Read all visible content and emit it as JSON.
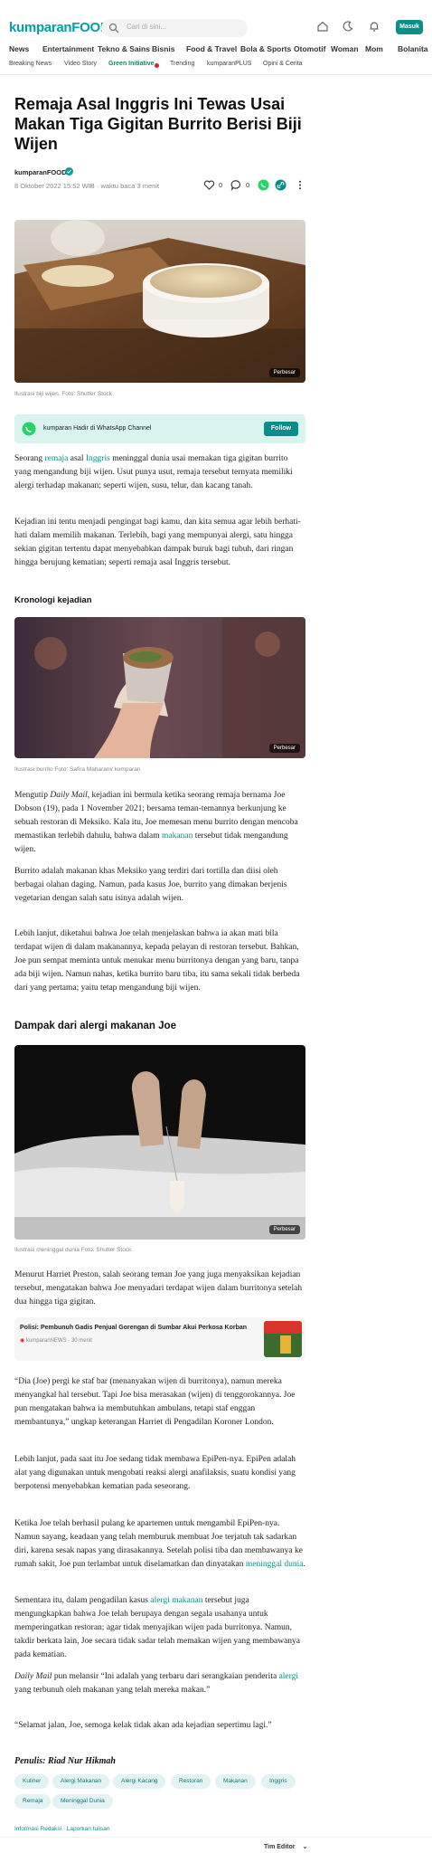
{
  "header": {
    "logo_main": "kumparan",
    "logo_sub": "FOOD",
    "search_placeholder": "Cari di sini...",
    "login_label": "Masuk"
  },
  "nav": {
    "items": [
      "News",
      "Entertainment",
      "Tekno & Sains",
      "Bisnis",
      "Food & Travel",
      "Bola & Sports",
      "Otomotif",
      "Woman",
      "Mom",
      "Bolanita"
    ]
  },
  "subnav": {
    "items": [
      "Breaking News",
      "Video Story",
      "Green Initiative",
      "Trending",
      "kumparanPLUS",
      "Opini & Cerita"
    ]
  },
  "article": {
    "title": "Remaja Asal Inggris Ini Tewas Usai Makan Tiga Gigitan Burrito Berisi Biji Wijen",
    "author": "kumparanFOOD",
    "meta": "8 Oktober 2022 15:52 WIB · waktu baca 3 menit",
    "likes": "0",
    "comments": "0"
  },
  "figures": {
    "zoom_label": "Perbesar",
    "caption1": "Ilustrasi biji wijen. Foto: Shutter Stock",
    "caption2": "Ilustrasi burrito Foto: Safira Maharani/ kumparan",
    "caption3": "Ilustrasi meninggal dunia Foto: Shutter Stock"
  },
  "wa_banner": {
    "text": "kumparan Hadir di WhatsApp Channel",
    "follow_label": "Follow"
  },
  "body": {
    "p1_a": "Seorang ",
    "p1_link1": "remaja",
    "p1_b": " asal ",
    "p1_link2": "Inggris",
    "p1_c": " meninggal dunia usai memakan tiga gigitan burrito yang mengandung biji wijen. Usut punya usut, remaja tersebut ternyata memiliki alergi terhadap makanan; seperti wijen, susu, telur, dan kacang tanah.",
    "p2": "Kejadian ini tentu menjadi pengingat bagi kamu, dan kita semua agar lebih berhati-hati dalam memilih makanan. Terlebih, bagi yang mempunyai alergi, satu hingga sekian gigitan tertentu dapat menyebabkan dampak buruk bagi tubuh, dari ringan hingga berujung kematian; seperti remaja asal Inggris tersebut.",
    "h_kronologi": "Kronologi kejadian",
    "p3_a": "Mengutip ",
    "p3_em": "Daily Mail",
    "p3_b": ", kejadian ini bermula ketika seorang remaja bernama Joe Dobson (19), pada 1 November 2021; bersama teman-temannya berkunjung ke sebuah restoran di Meksiko. Kala itu, Joe memesan menu burrito dengan mencoba memastikan terlebih dahulu, bahwa dalam ",
    "p3_link": "makanan",
    "p3_c": " tersebut tidak mengandung wijen.",
    "p4": "Burrito adalah makanan khas Meksiko yang terdiri dari tortilla dan diisi oleh berbagai olahan daging. Namun, pada kasus Joe, burrito yang dimakan berjenis vegetarian dengan salah satu isinya adalah wijen.",
    "p5": "Lebih lanjut, diketahui bahwa Joe telah menjelaskan bahwa ia akan mati bila terdapat wijen di dalam makanannya, kepada pelayan di restoran tersebut. Bahkan, Joe pun sempat meminta untuk menukar menu burritonya dengan yang baru, tanpa ada biji wijen. Namun nahas, ketika burrito baru tiba, itu sama sekali tidak berbeda dari yang pertama; yaitu tetap mengandung biji wijen.",
    "h_dampak": "Dampak dari alergi makanan Joe",
    "p6": "Menurut Harriet Preston, salah seorang teman Joe yang juga menyaksikan kejadian tersebut, mengatakan bahwa Joe menyadari terdapat wijen dalam burritonya setelah dua hingga tiga gigitan.",
    "p7": "“Dia (Joe) pergi ke staf bar (menanyakan wijen di burritonya), namun mereka menyangkal hal tersebut. Tapi Joe bisa merasakan (wijen) di tenggorokannya. Joe pun mengatakan bahwa ia membutuhkan ambulans, tetapi staf enggan membantunya,” ungkap keterangan Harriet di Pengadilan Koroner London.",
    "p8": "Lebih lanjut, pada saat itu Joe sedang tidak membawa EpiPen-nya. EpiPen adalah alat yang digunakan untuk mengobati reaksi alergi anafilaksis, suatu kondisi yang berpotensi menyebabkan kematian pada seseorang.",
    "p9_a": "Ketika Joe telah berhasil pulang ke apartemen untuk mengambil EpiPen-nya. Namun sayang, keadaan yang telah memburuk membuat Joe terjatuh tak sadarkan diri, karena sesak napas yang dirasakannya. Setelah polisi tiba dan membawanya ke rumah sakit, Joe pun terlambat untuk diselamatkan dan dinyatakan ",
    "p9_link": "meninggal dunia",
    "p9_b": ".",
    "p10_a": "Sementara itu, dalam pengadilan kasus ",
    "p10_link": "alergi makanan",
    "p10_b": " tersebut juga mengungkapkan bahwa Joe telah berupaya dengan segala usahanya untuk memperingatkan restoran; agar tidak menyajikan wijen pada burritonya. Namun, takdir berkata lain, Joe secara tidak sadar telah memakan wijen yang membawanya pada kematian.",
    "p11_em": "Daily Mail",
    "p11_a": " pun melansir “Ini adalah yang terbaru dari serangkaian penderita ",
    "p11_link": "alergi",
    "p11_b": " yang terbunuh oleh makanan yang telah mereka makan.”",
    "p12": "“Selamat jalan, Joe, semoga kelak tidak akan ada kejadian sepertimu lagi.”",
    "writer": "Penulis: Riad Nur Hikmah"
  },
  "related": {
    "title": "Polisi: Pembunuh Gadis Penjual Gorengan di Sumbar Akui Perkosa Korban",
    "source": "kumparanNEWS",
    "time": "30 menit"
  },
  "tags": [
    "Kuliner",
    "Alergi Makanan",
    "Alergi Kacang",
    "Restoran",
    "Makanan",
    "Inggris",
    "Remaja",
    "Meninggal Dunia"
  ],
  "footer": {
    "links": "Informasi Redaksi · Laporkan tulisan",
    "editor": "Tim Editor"
  },
  "colors": {
    "brand": "#00a0a6",
    "accent": "#0b8e8a",
    "whatsapp": "#25d366"
  }
}
